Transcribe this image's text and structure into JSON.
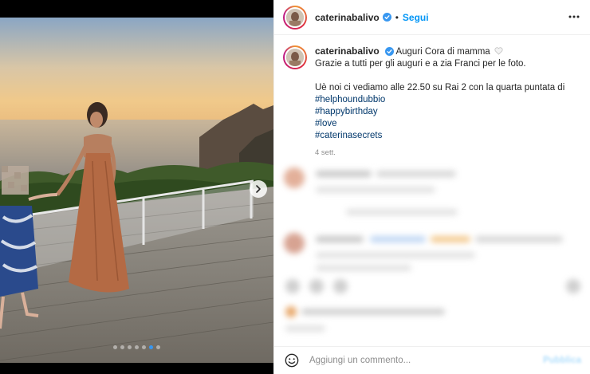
{
  "post": {
    "username": "caterinabalivo",
    "follow_label": "Segui",
    "separator": "•",
    "caption_lines": [
      "Auguri Cora di mamma",
      "Grazie a tutti per gli auguri e a zia Franci per le foto."
    ],
    "caption_line_3": "Uè noi ci vediamo alle 22.50 su Rai 2 con la quarta puntata di",
    "hashtags": [
      "#helphoundubbio",
      "#happybirthday",
      "#love",
      "#caterinasecrets"
    ],
    "time_ago": "4 sett."
  },
  "carousel": {
    "total_slides": 7,
    "active_slide": 6
  },
  "comment_box": {
    "placeholder": "Aggiungi un commento...",
    "publish_label": "Pubblica"
  },
  "icons": {
    "verified": "verified-badge-icon",
    "more": "more-horizontal-icon",
    "next": "chevron-right-icon",
    "emoji": "smiley-icon",
    "heart": "white-heart-icon"
  },
  "colors": {
    "accent": "#0095f6",
    "hashtag": "#00376b",
    "muted": "#8e8e8e"
  }
}
